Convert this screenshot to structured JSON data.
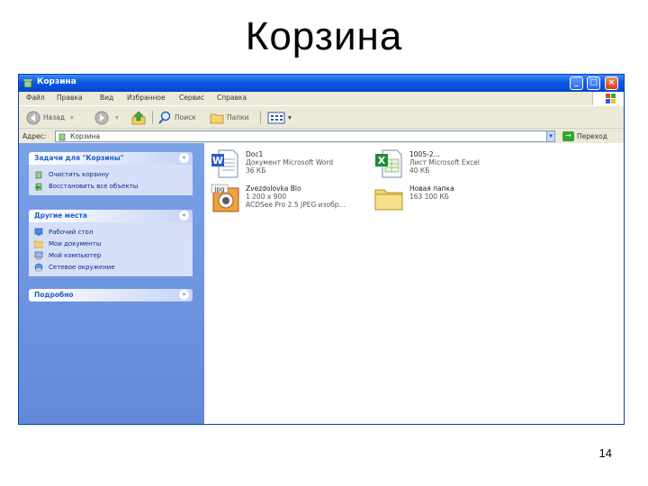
{
  "slide": {
    "title": "Корзина",
    "number": "14"
  },
  "window": {
    "title": "Корзина",
    "controls": {
      "minimize": "_",
      "maximize": "□",
      "close": "×"
    }
  },
  "menu": [
    "Файл",
    "Правка",
    "Вид",
    "Избранное",
    "Сервис",
    "Справка"
  ],
  "toolbar": {
    "back": "Назад",
    "search": "Поиск",
    "folders": "Папки"
  },
  "address": {
    "label": "Адрес:",
    "value": "Корзина",
    "go": "Переход"
  },
  "tasks": {
    "panel1": {
      "title": "Задачи для \"Корзины\"",
      "items": [
        {
          "label": "Очистить корзину",
          "icon": "recycle-bin-icon"
        },
        {
          "label": "Восстановить все объекты",
          "icon": "restore-icon"
        }
      ]
    },
    "panel2": {
      "title": "Другие места",
      "items": [
        {
          "label": "Рабочий стол",
          "icon": "desktop-icon"
        },
        {
          "label": "Мои документы",
          "icon": "my-documents-icon"
        },
        {
          "label": "Мой компьютер",
          "icon": "my-computer-icon"
        },
        {
          "label": "Сетевое окружение",
          "icon": "network-icon"
        }
      ]
    },
    "panel3": {
      "title": "Подробно"
    }
  },
  "files": [
    {
      "name": "Doc1",
      "type": "Документ Microsoft Word",
      "size": "36 КБ",
      "icon": "word-document-icon"
    },
    {
      "name": "1005-2...",
      "type": "Лист Microsoft Excel",
      "size": "40 КБ",
      "icon": "excel-sheet-icon"
    },
    {
      "name": "Zvezdolovka Blo",
      "type": "1 200 x 900",
      "size": "ACDSee Pro 2.5 JPEG изобр...",
      "icon": "jpeg-image-icon"
    },
    {
      "name": "Новая папка",
      "type": "163 100 КБ",
      "size": "",
      "icon": "folder-icon"
    }
  ],
  "colors": {
    "titlebar": "#0a58e6",
    "taskpane": "#6f95de",
    "panel_body": "#d6dff7",
    "link": "#0c2a88"
  }
}
